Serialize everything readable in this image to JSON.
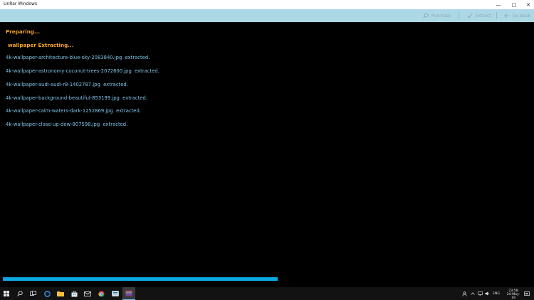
{
  "window": {
    "title": "UnRar Windows",
    "controls": {
      "minimize": "—",
      "maximize": "□",
      "close": "✕"
    }
  },
  "toolbar": {
    "purchase_label": "Purchase",
    "extract_label": "Extract",
    "go_back_label": "Go Back",
    "purchase_icon": "search-icon",
    "extract_icon": "check-icon",
    "go_back_icon": "arrow-left-icon"
  },
  "main": {
    "status_preparing": "Preparing...",
    "status_extracting": "wallpaper Extracting...",
    "log": [
      {
        "file": "4k-wallpaper-architecture-blue-sky-2083840.jpg",
        "status": "extracted."
      },
      {
        "file": "4k-wallpaper-astronomy-coconut-trees-2072600.jpg",
        "status": "extracted."
      },
      {
        "file": "4k-wallpaper-audi-audi-r8-1402787.jpg",
        "status": "extracted."
      },
      {
        "file": "4k-wallpaper-background-beautiful-853199.jpg",
        "status": "extracted."
      },
      {
        "file": "4k-wallpaper-calm-waters-dark-1252869.jpg",
        "status": "extracted."
      },
      {
        "file": "4k-wallpaper-close-up-dew-807598.jpg",
        "status": "extracted."
      }
    ],
    "progress_fraction": 0.52
  },
  "colors": {
    "toolbar_bg": "#acd8e6",
    "status_orange": "#f5a623",
    "log_blue": "#7fc4e8",
    "progress_blue": "#0aa9e4"
  },
  "taskbar": {
    "icons": [
      "windows-start-icon",
      "search-icon",
      "task-view-icon",
      "edge-icon",
      "file-explorer-icon",
      "store-icon",
      "mail-icon",
      "chrome-icon",
      "app-icon",
      "unrar-icon"
    ],
    "tray": {
      "language": "ENG",
      "time": "23:58",
      "date": "24-May-19"
    }
  }
}
